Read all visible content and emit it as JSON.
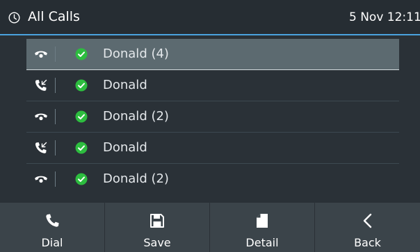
{
  "header": {
    "icon": "clock-icon",
    "title": "All Calls",
    "datetime": "5 Nov 12:11"
  },
  "calls": [
    {
      "type": "missed-call-icon",
      "status": "check-circle-icon",
      "name": "Donald (4)",
      "selected": true
    },
    {
      "type": "received-call-icon",
      "status": "check-circle-icon",
      "name": "Donald",
      "selected": false
    },
    {
      "type": "missed-call-icon",
      "status": "check-circle-icon",
      "name": "Donald (2)",
      "selected": false
    },
    {
      "type": "received-call-icon",
      "status": "check-circle-icon",
      "name": "Donald",
      "selected": false
    },
    {
      "type": "missed-call-icon",
      "status": "check-circle-icon",
      "name": "Donald (2)",
      "selected": false
    }
  ],
  "softkeys": [
    {
      "label": "Dial",
      "icon": "phone-icon"
    },
    {
      "label": "Save",
      "icon": "floppy-disk-icon"
    },
    {
      "label": "Detail",
      "icon": "document-icon"
    },
    {
      "label": "Back",
      "icon": "chevron-left-icon"
    }
  ],
  "colors": {
    "accent": "#4aa3df",
    "check": "#2dbd3f",
    "selected_row": "#5c6a70"
  }
}
